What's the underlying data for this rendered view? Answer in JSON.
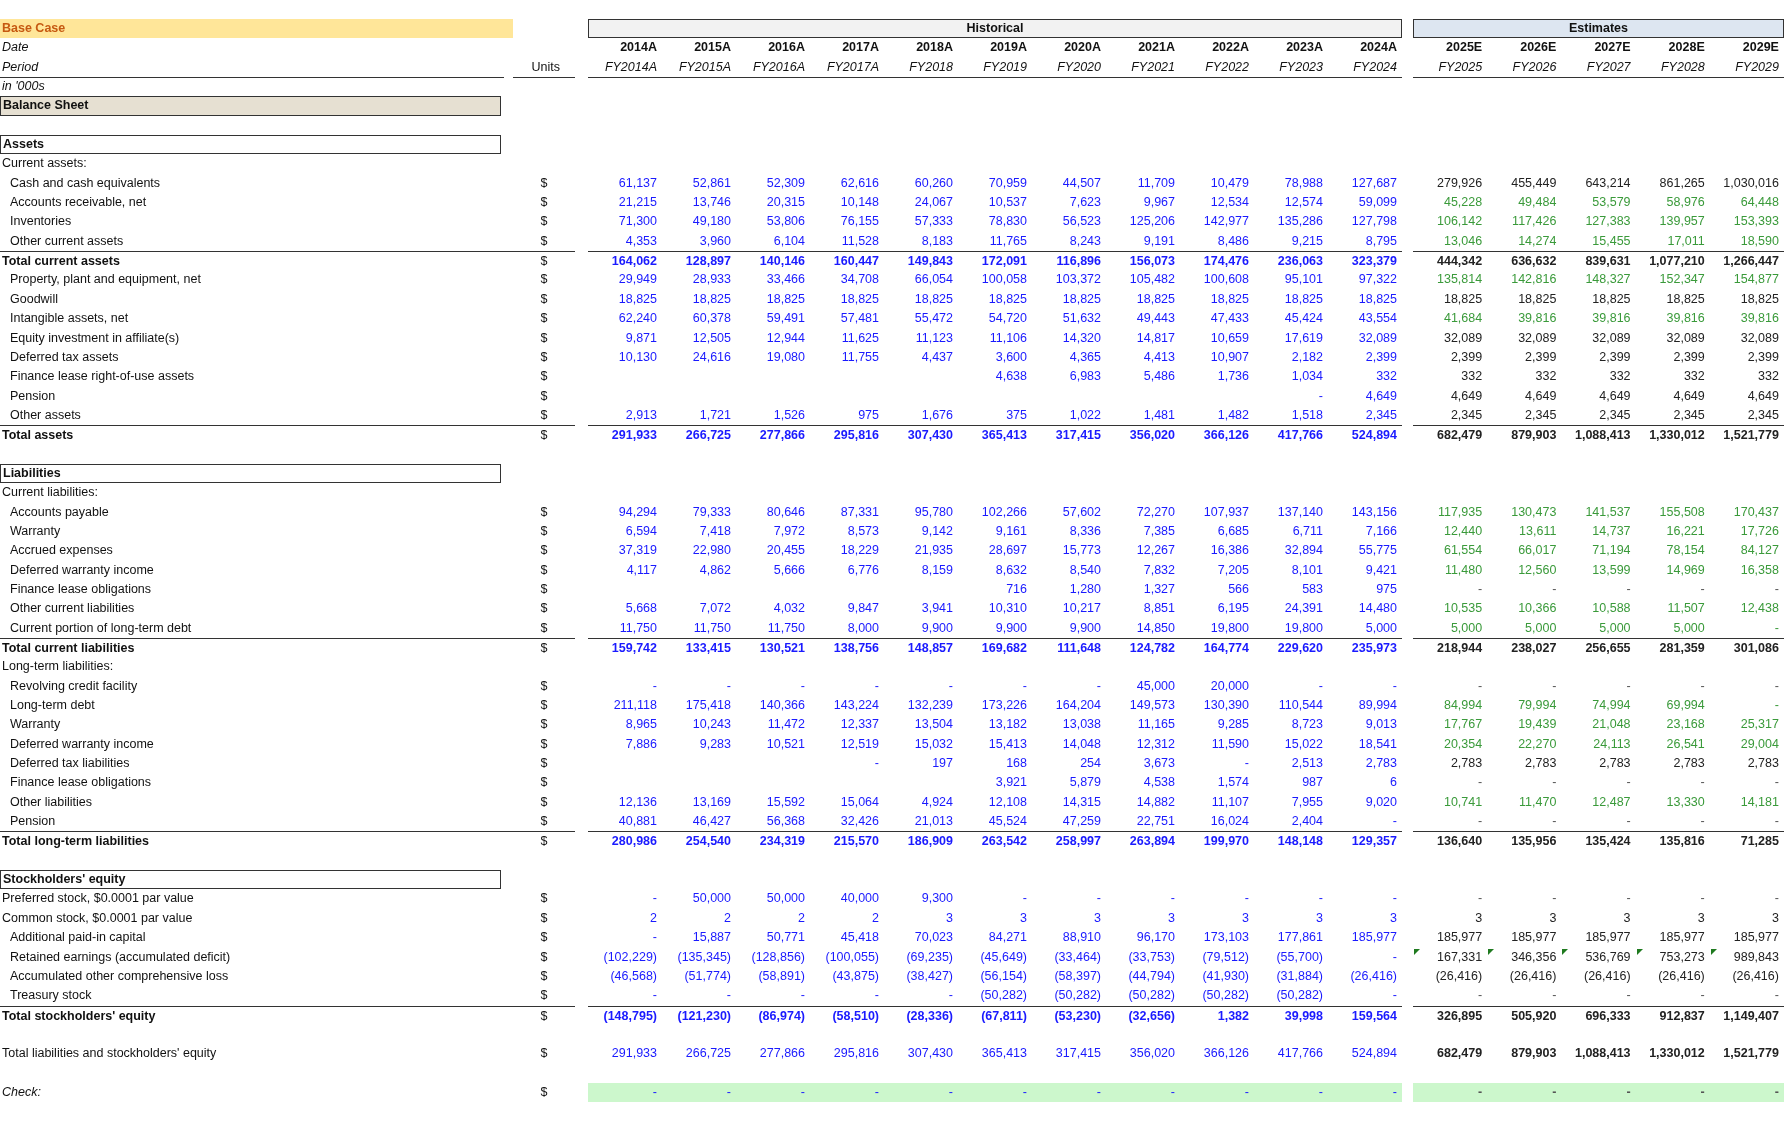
{
  "title": "Base Case",
  "header": {
    "historical_label": "Historical",
    "estimates_label": "Estimates",
    "date_label": "Date",
    "period_label": "Period",
    "units_label": "Units",
    "scale_label": "in '000s",
    "historical": [
      {
        "year": "2014A",
        "period": "FY2014A"
      },
      {
        "year": "2015A",
        "period": "FY2015A"
      },
      {
        "year": "2016A",
        "period": "FY2016A"
      },
      {
        "year": "2017A",
        "period": "FY2017A"
      },
      {
        "year": "2018A",
        "period": "FY2018"
      },
      {
        "year": "2019A",
        "period": "FY2019"
      },
      {
        "year": "2020A",
        "period": "FY2020"
      },
      {
        "year": "2021A",
        "period": "FY2021"
      },
      {
        "year": "2022A",
        "period": "FY2022"
      },
      {
        "year": "2023A",
        "period": "FY2023"
      },
      {
        "year": "2024A",
        "period": "FY2024"
      }
    ],
    "estimates": [
      {
        "year": "2025E",
        "period": "FY2025"
      },
      {
        "year": "2026E",
        "period": "FY2026"
      },
      {
        "year": "2027E",
        "period": "FY2027"
      },
      {
        "year": "2028E",
        "period": "FY2028"
      },
      {
        "year": "2029E",
        "period": "FY2029"
      }
    ]
  },
  "sheet_title": "Balance Sheet",
  "rows": [
    {
      "kind": "blank"
    },
    {
      "kind": "section",
      "label": "Assets"
    },
    {
      "kind": "subhead",
      "label": "Current assets:"
    },
    {
      "kind": "item",
      "label": "Cash and cash equivalents",
      "units": "$",
      "hist": [
        "61,137",
        "52,861",
        "52,309",
        "62,616",
        "60,260",
        "70,959",
        "44,507",
        "11,709",
        "10,479",
        "78,988",
        "127,687"
      ],
      "est": [
        "279,926",
        "455,449",
        "643,214",
        "861,265",
        "1,030,016"
      ],
      "color": "#222222"
    },
    {
      "kind": "item",
      "label": "Accounts receivable, net",
      "units": "$",
      "hist": [
        "21,215",
        "13,746",
        "20,315",
        "10,148",
        "24,067",
        "10,537",
        "7,623",
        "9,967",
        "12,534",
        "12,574",
        "59,099"
      ],
      "est": [
        "45,228",
        "49,484",
        "53,579",
        "58,976",
        "64,448"
      ],
      "color": "#3a9a3a"
    },
    {
      "kind": "item",
      "label": "Inventories",
      "units": "$",
      "hist": [
        "71,300",
        "49,180",
        "53,806",
        "76,155",
        "57,333",
        "78,830",
        "56,523",
        "125,206",
        "142,977",
        "135,286",
        "127,798"
      ],
      "est": [
        "106,142",
        "117,426",
        "127,383",
        "139,957",
        "153,393"
      ],
      "color": "#3a9a3a"
    },
    {
      "kind": "item",
      "label": "Other current assets",
      "units": "$",
      "hist": [
        "4,353",
        "3,960",
        "6,104",
        "11,528",
        "8,183",
        "11,765",
        "8,243",
        "9,191",
        "8,486",
        "9,215",
        "8,795"
      ],
      "est": [
        "13,046",
        "14,274",
        "15,455",
        "17,011",
        "18,590"
      ],
      "color": "#3a9a3a"
    },
    {
      "kind": "total",
      "label": "Total current assets",
      "units": "$",
      "hist": [
        "164,062",
        "128,897",
        "140,146",
        "160,447",
        "149,843",
        "172,091",
        "116,896",
        "156,073",
        "174,476",
        "236,063",
        "323,379"
      ],
      "est": [
        "444,342",
        "636,632",
        "839,631",
        "1,077,210",
        "1,266,447"
      ],
      "color": "#222222"
    },
    {
      "kind": "item",
      "label": "Property, plant and equipment, net",
      "units": "$",
      "hist": [
        "29,949",
        "28,933",
        "33,466",
        "34,708",
        "66,054",
        "100,058",
        "103,372",
        "105,482",
        "100,608",
        "95,101",
        "97,322"
      ],
      "est": [
        "135,814",
        "142,816",
        "148,327",
        "152,347",
        "154,877"
      ],
      "color": "#3a9a3a"
    },
    {
      "kind": "item",
      "label": "Goodwill",
      "units": "$",
      "hist": [
        "18,825",
        "18,825",
        "18,825",
        "18,825",
        "18,825",
        "18,825",
        "18,825",
        "18,825",
        "18,825",
        "18,825",
        "18,825"
      ],
      "est": [
        "18,825",
        "18,825",
        "18,825",
        "18,825",
        "18,825"
      ],
      "color": "#222222"
    },
    {
      "kind": "item",
      "label": "Intangible assets, net",
      "units": "$",
      "hist": [
        "62,240",
        "60,378",
        "59,491",
        "57,481",
        "55,472",
        "54,720",
        "51,632",
        "49,443",
        "47,433",
        "45,424",
        "43,554"
      ],
      "est": [
        "41,684",
        "39,816",
        "39,816",
        "39,816",
        "39,816"
      ],
      "color": "#3a9a3a"
    },
    {
      "kind": "item",
      "label": "Equity investment in affiliate(s)",
      "units": "$",
      "hist": [
        "9,871",
        "12,505",
        "12,944",
        "11,625",
        "11,123",
        "11,106",
        "14,320",
        "14,817",
        "10,659",
        "17,619",
        "32,089"
      ],
      "est": [
        "32,089",
        "32,089",
        "32,089",
        "32,089",
        "32,089"
      ],
      "color": "#222222"
    },
    {
      "kind": "item",
      "label": "Deferred tax assets",
      "units": "$",
      "hist": [
        "10,130",
        "24,616",
        "19,080",
        "11,755",
        "4,437",
        "3,600",
        "4,365",
        "4,413",
        "10,907",
        "2,182",
        "2,399"
      ],
      "est": [
        "2,399",
        "2,399",
        "2,399",
        "2,399",
        "2,399"
      ],
      "color": "#222222"
    },
    {
      "kind": "item",
      "label": "Finance lease right-of-use assets",
      "units": "$",
      "hist": [
        "4,638",
        "6,983",
        "5,486",
        "1,736",
        "1,034",
        "332"
      ],
      "est": [
        "332",
        "332",
        "332",
        "332",
        "332"
      ],
      "color": "#222222"
    },
    {
      "kind": "item",
      "label": "Pension",
      "units": "$",
      "hist": [
        "-",
        "4,649"
      ],
      "est": [
        "4,649",
        "4,649",
        "4,649",
        "4,649",
        "4,649"
      ],
      "color": "#222222"
    },
    {
      "kind": "item",
      "label": "Other assets",
      "units": "$",
      "hist": [
        "2,913",
        "1,721",
        "1,526",
        "975",
        "1,676",
        "375",
        "1,022",
        "1,481",
        "1,482",
        "1,518",
        "2,345"
      ],
      "est": [
        "2,345",
        "2,345",
        "2,345",
        "2,345",
        "2,345"
      ],
      "color": "#222222"
    },
    {
      "kind": "total",
      "label": "Total assets",
      "units": "$",
      "hist": [
        "291,933",
        "266,725",
        "277,866",
        "295,816",
        "307,430",
        "365,413",
        "317,415",
        "356,020",
        "366,126",
        "417,766",
        "524,894"
      ],
      "est": [
        "682,479",
        "879,903",
        "1,088,413",
        "1,330,012",
        "1,521,779"
      ],
      "color": "#222222"
    },
    {
      "kind": "blank"
    },
    {
      "kind": "section",
      "label": "Liabilities"
    },
    {
      "kind": "subhead",
      "label": "Current liabilities:"
    },
    {
      "kind": "item",
      "label": "Accounts payable",
      "units": "$",
      "hist": [
        "94,294",
        "79,333",
        "80,646",
        "87,331",
        "95,780",
        "102,266",
        "57,602",
        "72,270",
        "107,937",
        "137,140",
        "143,156"
      ],
      "est": [
        "117,935",
        "130,473",
        "141,537",
        "155,508",
        "170,437"
      ],
      "color": "#3a9a3a"
    },
    {
      "kind": "item",
      "label": "Warranty",
      "units": "$",
      "hist": [
        "6,594",
        "7,418",
        "7,972",
        "8,573",
        "9,142",
        "9,161",
        "8,336",
        "7,385",
        "6,685",
        "6,711",
        "7,166"
      ],
      "est": [
        "12,440",
        "13,611",
        "14,737",
        "16,221",
        "17,726"
      ],
      "color": "#3a9a3a"
    },
    {
      "kind": "item",
      "label": "Accrued expenses",
      "units": "$",
      "hist": [
        "37,319",
        "22,980",
        "20,455",
        "18,229",
        "21,935",
        "28,697",
        "15,773",
        "12,267",
        "16,386",
        "32,894",
        "55,775"
      ],
      "est": [
        "61,554",
        "66,017",
        "71,194",
        "78,154",
        "84,127"
      ],
      "color": "#3a9a3a"
    },
    {
      "kind": "item",
      "label": "Deferred warranty income",
      "units": "$",
      "hist": [
        "4,117",
        "4,862",
        "5,666",
        "6,776",
        "8,159",
        "8,632",
        "8,540",
        "7,832",
        "7,205",
        "8,101",
        "9,421"
      ],
      "est": [
        "11,480",
        "12,560",
        "13,599",
        "14,969",
        "16,358"
      ],
      "color": "#3a9a3a"
    },
    {
      "kind": "item",
      "label": "Finance lease obligations",
      "units": "$",
      "hist": [
        "716",
        "1,280",
        "1,327",
        "566",
        "583",
        "975"
      ],
      "est": [
        "-",
        "-",
        "-",
        "-",
        "-"
      ]
    },
    {
      "kind": "item",
      "label": "Other current liabilities",
      "units": "$",
      "hist": [
        "5,668",
        "7,072",
        "4,032",
        "9,847",
        "3,941",
        "10,310",
        "10,217",
        "8,851",
        "6,195",
        "24,391",
        "14,480"
      ],
      "est": [
        "10,535",
        "10,366",
        "10,588",
        "11,507",
        "12,438"
      ],
      "color": "#3a9a3a"
    },
    {
      "kind": "item",
      "label": "Current portion of long-term debt",
      "units": "$",
      "hist": [
        "11,750",
        "11,750",
        "11,750",
        "8,000",
        "9,900",
        "9,900",
        "9,900",
        "14,850",
        "19,800",
        "19,800",
        "5,000"
      ],
      "est": [
        "5,000",
        "5,000",
        "5,000",
        "5,000",
        "-"
      ],
      "color": "#3a9a3a"
    },
    {
      "kind": "total",
      "label": "Total current liabilities",
      "units": "$",
      "hist": [
        "159,742",
        "133,415",
        "130,521",
        "138,756",
        "148,857",
        "169,682",
        "111,648",
        "124,782",
        "164,774",
        "229,620",
        "235,973"
      ],
      "est": [
        "218,944",
        "238,027",
        "256,655",
        "281,359",
        "301,086"
      ],
      "color": "#222222"
    },
    {
      "kind": "subhead",
      "label": "Long-term liabilities:"
    },
    {
      "kind": "item",
      "label": "Revolving credit facility",
      "units": "$",
      "hist": [
        "-",
        "-",
        "-",
        "-",
        "-",
        "-",
        "-",
        "45,000",
        "20,000",
        "-",
        "-"
      ],
      "est": [
        "-",
        "-",
        "-",
        "-",
        "-"
      ]
    },
    {
      "kind": "item",
      "label": "Long-term debt",
      "units": "$",
      "hist": [
        "211,118",
        "175,418",
        "140,366",
        "143,224",
        "132,239",
        "173,226",
        "164,204",
        "149,573",
        "130,390",
        "110,544",
        "89,994"
      ],
      "est": [
        "84,994",
        "79,994",
        "74,994",
        "69,994",
        "-"
      ],
      "color": "#3a9a3a"
    },
    {
      "kind": "item",
      "label": "Warranty",
      "units": "$",
      "hist": [
        "8,965",
        "10,243",
        "11,472",
        "12,337",
        "13,504",
        "13,182",
        "13,038",
        "11,165",
        "9,285",
        "8,723",
        "9,013"
      ],
      "est": [
        "17,767",
        "19,439",
        "21,048",
        "23,168",
        "25,317"
      ],
      "color": "#3a9a3a"
    },
    {
      "kind": "item",
      "label": "Deferred warranty income",
      "units": "$",
      "hist": [
        "7,886",
        "9,283",
        "10,521",
        "12,519",
        "15,032",
        "15,413",
        "14,048",
        "12,312",
        "11,590",
        "15,022",
        "18,541"
      ],
      "est": [
        "20,354",
        "22,270",
        "24,113",
        "26,541",
        "29,004"
      ],
      "color": "#3a9a3a"
    },
    {
      "kind": "item",
      "label": "Deferred tax liabilities",
      "units": "$",
      "hist": [
        "-",
        "197",
        "168",
        "254",
        "3,673",
        "-",
        "2,513",
        "2,783"
      ],
      "est": [
        "2,783",
        "2,783",
        "2,783",
        "2,783",
        "2,783"
      ],
      "color": "#222222"
    },
    {
      "kind": "item",
      "label": "Finance lease obligations",
      "units": "$",
      "hist": [
        "3,921",
        "5,879",
        "4,538",
        "1,574",
        "987",
        "6"
      ],
      "est": [
        "-",
        "-",
        "-",
        "-",
        "-"
      ]
    },
    {
      "kind": "item",
      "label": "Other liabilities",
      "units": "$",
      "hist": [
        "12,136",
        "13,169",
        "15,592",
        "15,064",
        "4,924",
        "12,108",
        "14,315",
        "14,882",
        "11,107",
        "7,955",
        "9,020"
      ],
      "est": [
        "10,741",
        "11,470",
        "12,487",
        "13,330",
        "14,181"
      ],
      "color": "#3a9a3a"
    },
    {
      "kind": "item",
      "label": "Pension",
      "units": "$",
      "hist": [
        "40,881",
        "46,427",
        "56,368",
        "32,426",
        "21,013",
        "45,524",
        "47,259",
        "22,751",
        "16,024",
        "2,404",
        "-"
      ],
      "est": [
        "-",
        "-",
        "-",
        "-",
        "-"
      ]
    },
    {
      "kind": "total",
      "label": "Total long-term liabilities",
      "units": "$",
      "hist": [
        "280,986",
        "254,540",
        "234,319",
        "215,570",
        "186,909",
        "263,542",
        "258,997",
        "263,894",
        "199,970",
        "148,148",
        "129,357"
      ],
      "est": [
        "136,640",
        "135,956",
        "135,424",
        "135,816",
        "71,285"
      ],
      "color": "#222222"
    },
    {
      "kind": "blank"
    },
    {
      "kind": "section",
      "label": "Stockholders' equity"
    },
    {
      "kind": "line",
      "label": "Preferred stock, $0.0001 par value",
      "units": "$",
      "hist": [
        "-",
        "50,000",
        "50,000",
        "40,000",
        "9,300",
        "-",
        "-",
        "-",
        "-",
        "-",
        "-"
      ],
      "est": [
        "-",
        "-",
        "-",
        "-",
        "-"
      ]
    },
    {
      "kind": "line",
      "label": "Common stock, $0.0001 par value",
      "units": "$",
      "hist": [
        "2",
        "2",
        "2",
        "2",
        "3",
        "3",
        "3",
        "3",
        "3",
        "3",
        "3"
      ],
      "est": [
        "3",
        "3",
        "3",
        "3",
        "3"
      ],
      "color": "#222222"
    },
    {
      "kind": "item",
      "label": "Additional paid-in capital",
      "units": "$",
      "hist": [
        "-",
        "15,887",
        "50,771",
        "45,418",
        "70,023",
        "84,271",
        "88,910",
        "96,170",
        "173,103",
        "177,861",
        "185,977"
      ],
      "est": [
        "185,977",
        "185,977",
        "185,977",
        "185,977",
        "185,977"
      ],
      "color": "#222222"
    },
    {
      "kind": "item",
      "label": "Retained earnings (accumulated deficit)",
      "units": "$",
      "hist": [
        "(102,229)",
        "(135,345)",
        "(128,856)",
        "(100,055)",
        "(69,235)",
        "(45,649)",
        "(33,464)",
        "(33,753)",
        "(79,512)",
        "(55,700)",
        "-"
      ],
      "est": [
        "167,331",
        "346,356",
        "536,769",
        "753,273",
        "989,843"
      ],
      "color": "#222222",
      "flagged": true
    },
    {
      "kind": "item",
      "label": "Accumulated other comprehensive loss",
      "units": "$",
      "hist": [
        "(46,568)",
        "(51,774)",
        "(58,891)",
        "(43,875)",
        "(38,427)",
        "(56,154)",
        "(58,397)",
        "(44,794)",
        "(41,930)",
        "(31,884)",
        "(26,416)"
      ],
      "est": [
        "(26,416)",
        "(26,416)",
        "(26,416)",
        "(26,416)",
        "(26,416)"
      ],
      "color": "#222222"
    },
    {
      "kind": "item",
      "label": "Treasury stock",
      "units": "$",
      "hist": [
        "-",
        "-",
        "-",
        "-",
        "-",
        "(50,282)",
        "(50,282)",
        "(50,282)",
        "(50,282)",
        "(50,282)",
        "-"
      ],
      "est": [
        "-",
        "-",
        "-",
        "-",
        "-"
      ]
    },
    {
      "kind": "total",
      "label": "Total stockholders' equity",
      "units": "$",
      "hist": [
        "(148,795)",
        "(121,230)",
        "(86,974)",
        "(58,510)",
        "(28,336)",
        "(67,811)",
        "(53,230)",
        "(32,656)",
        "1,382",
        "39,998",
        "159,564"
      ],
      "est": [
        "326,895",
        "505,920",
        "696,333",
        "912,837",
        "1,149,407"
      ],
      "color": "#222222"
    },
    {
      "kind": "blank"
    },
    {
      "kind": "grand",
      "label": "Total liabilities and stockholders' equity",
      "units": "$",
      "hist": [
        "291,933",
        "266,725",
        "277,866",
        "295,816",
        "307,430",
        "365,413",
        "317,415",
        "356,020",
        "366,126",
        "417,766",
        "524,894"
      ],
      "est": [
        "682,479",
        "879,903",
        "1,088,413",
        "1,330,012",
        "1,521,779"
      ],
      "color": "#222222"
    },
    {
      "kind": "blank"
    },
    {
      "kind": "check",
      "label": "Check:",
      "units": "$",
      "hist": [
        "-",
        "-",
        "-",
        "-",
        "-",
        "-",
        "-",
        "-",
        "-",
        "-",
        "-"
      ],
      "est": [
        "-",
        "-",
        "-",
        "-",
        "-"
      ]
    }
  ]
}
